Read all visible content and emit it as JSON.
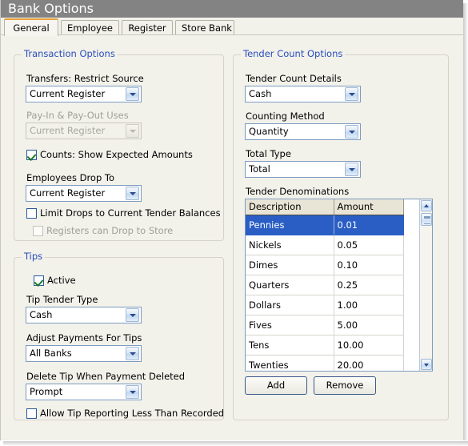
{
  "window": {
    "title": "Bank Options"
  },
  "tabs": [
    {
      "label": "General",
      "active": true
    },
    {
      "label": "Employee",
      "active": false
    },
    {
      "label": "Register",
      "active": false
    },
    {
      "label": "Store Bank",
      "active": false
    }
  ],
  "transaction_options": {
    "legend": "Transaction Options",
    "transfers_restrict_source": {
      "label": "Transfers: Restrict Source",
      "value": "Current Register",
      "enabled": true
    },
    "pay_in_pay_out_uses": {
      "label": "Pay-In & Pay-Out Uses",
      "value": "Current Register",
      "enabled": false
    },
    "counts_show_expected": {
      "label": "Counts: Show Expected Amounts",
      "checked": true,
      "enabled": true
    },
    "employees_drop_to": {
      "label": "Employees Drop To",
      "value": "Current Register",
      "enabled": true
    },
    "limit_drops": {
      "label": "Limit Drops to Current Tender Balances",
      "checked": false,
      "enabled": true
    },
    "registers_can_drop": {
      "label": "Registers can Drop to Store",
      "checked": false,
      "enabled": false
    }
  },
  "tips": {
    "legend": "Tips",
    "active": {
      "label": "Active",
      "checked": true,
      "enabled": true
    },
    "tip_tender_type": {
      "label": "Tip Tender Type",
      "value": "Cash"
    },
    "adjust_payments": {
      "label": "Adjust Payments For Tips",
      "value": "All Banks"
    },
    "delete_tip": {
      "label": "Delete Tip When Payment Deleted",
      "value": "Prompt"
    },
    "allow_tip_reporting": {
      "label": "Allow Tip Reporting Less Than Recorded",
      "checked": false,
      "enabled": true
    }
  },
  "tender_count_options": {
    "legend": "Tender Count Options",
    "tender_count_details": {
      "label": "Tender Count Details",
      "value": "Cash"
    },
    "counting_method": {
      "label": "Counting Method",
      "value": "Quantity"
    },
    "total_type": {
      "label": "Total Type",
      "value": "Total"
    },
    "denominations": {
      "label": "Tender Denominations",
      "columns": [
        "Description",
        "Amount"
      ],
      "rows": [
        {
          "description": "Pennies",
          "amount": "0.01",
          "selected": true
        },
        {
          "description": "Nickels",
          "amount": "0.05",
          "selected": false
        },
        {
          "description": "Dimes",
          "amount": "0.10",
          "selected": false
        },
        {
          "description": "Quarters",
          "amount": "0.25",
          "selected": false
        },
        {
          "description": "Dollars",
          "amount": "1.00",
          "selected": false
        },
        {
          "description": "Fives",
          "amount": "5.00",
          "selected": false
        },
        {
          "description": "Tens",
          "amount": "10.00",
          "selected": false
        },
        {
          "description": "Twenties",
          "amount": "20.00",
          "selected": false
        }
      ]
    },
    "add_button": "Add",
    "remove_button": "Remove"
  },
  "colors": {
    "titlebar": "#838383",
    "active_tab_accent": "#e8a03a",
    "group_legend": "#2a4ebd",
    "selection": "#2a5ec4",
    "grid_header": "#e9e5d6",
    "page_background": "#f2f1ea"
  }
}
